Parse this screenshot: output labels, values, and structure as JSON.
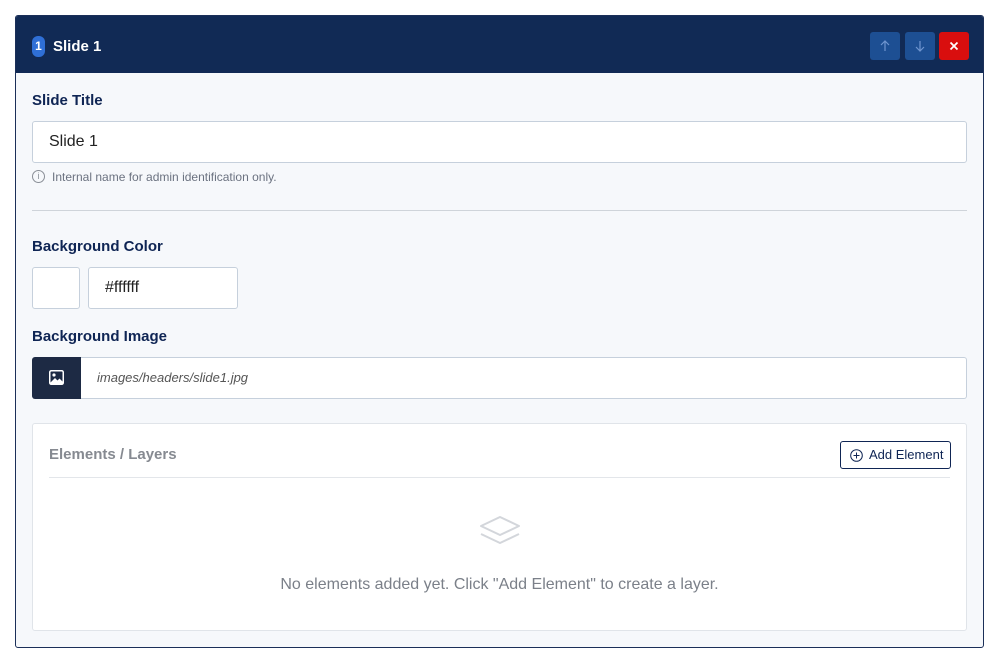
{
  "header": {
    "slide_number": "1",
    "title": "Slide 1",
    "move_up_icon": "arrow-up-icon",
    "move_down_icon": "arrow-down-icon",
    "close_icon": "close-icon",
    "colors": {
      "bar": "#112a55",
      "move_buttons": "#1d4f93",
      "close_button": "#d90e0e"
    }
  },
  "slide_title": {
    "label": "Slide Title",
    "value": "Slide 1",
    "help_icon": "info-icon",
    "help_text": "Internal name for admin identification only."
  },
  "background_color": {
    "label": "Background Color",
    "swatch_color": "#ffffff",
    "value": "#ffffff"
  },
  "background_image": {
    "label": "Background Image",
    "picker_icon": "image-icon",
    "value": "images/headers/slide1.jpg"
  },
  "layers": {
    "title": "Elements / Layers",
    "add_button_icon": "plus-circle-icon",
    "add_button_label": "Add Element",
    "empty_icon": "layers-icon",
    "empty_text": "No elements added yet. Click \"Add Element\" to create a layer."
  }
}
